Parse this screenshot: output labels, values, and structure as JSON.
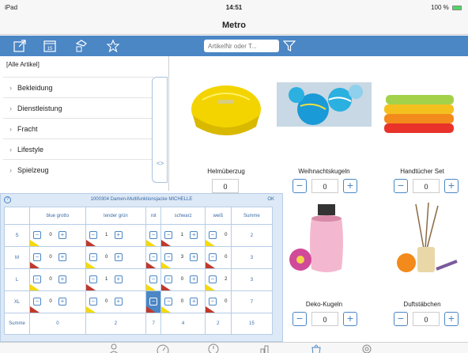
{
  "status": {
    "device": "iPad",
    "time": "14:51",
    "battery": "100 %"
  },
  "title": "Metro",
  "toolbar": {
    "icons": [
      "share-icon",
      "calendar-icon",
      "scanner-icon",
      "star-icon"
    ],
    "calendar_day": "15",
    "search_placeholder": "ArtikelNr oder T..."
  },
  "sidebar": {
    "all": "[Alle Artikel]",
    "items": [
      "Bekleidung",
      "Dienstleistung",
      "Fracht",
      "Lifestyle",
      "Spielzeug"
    ]
  },
  "products": [
    {
      "name": "Helmüberzug",
      "qty": "0",
      "stepper": false
    },
    {
      "name": "Weihnachtskugeln",
      "qty": "0",
      "stepper": true
    },
    {
      "name": "Handtücher Set",
      "qty": "0",
      "stepper": true
    },
    {
      "name": "Deko-Kugeln",
      "qty": "0",
      "stepper": true
    },
    {
      "name": "Duftstäbchen",
      "qty": "0",
      "stepper": true
    }
  ],
  "dialog": {
    "help": "?",
    "title": "1000304 Damen-Multifunktionsjacke MICHELLE",
    "ok": "OK",
    "columns": [
      "blue grotto",
      "tender grün",
      "rot",
      "schwarz",
      "weiß",
      "Summe"
    ],
    "rows": [
      {
        "label": "S",
        "values": [
          "0",
          "1",
          "0",
          "1",
          "0"
        ],
        "sum": "2"
      },
      {
        "label": "M",
        "values": [
          "0",
          "0",
          "0",
          "3",
          "0"
        ],
        "sum": "3"
      },
      {
        "label": "L",
        "values": [
          "0",
          "1",
          "0",
          "0",
          "2"
        ],
        "sum": "3"
      },
      {
        "label": "XL",
        "values": [
          "0",
          "0",
          "7",
          "0",
          "0"
        ],
        "sum": "7"
      }
    ],
    "total_label": "Summe",
    "totals": [
      "0",
      "2",
      "7",
      "4",
      "2",
      "15"
    ],
    "corner_colors": [
      "#f5d90a",
      "#c0392b"
    ]
  },
  "tabbar": {
    "icons": [
      "customer-icon",
      "dashboard-icon",
      "alarm-icon",
      "stats-icon",
      "cart-icon",
      "settings-icon"
    ]
  }
}
